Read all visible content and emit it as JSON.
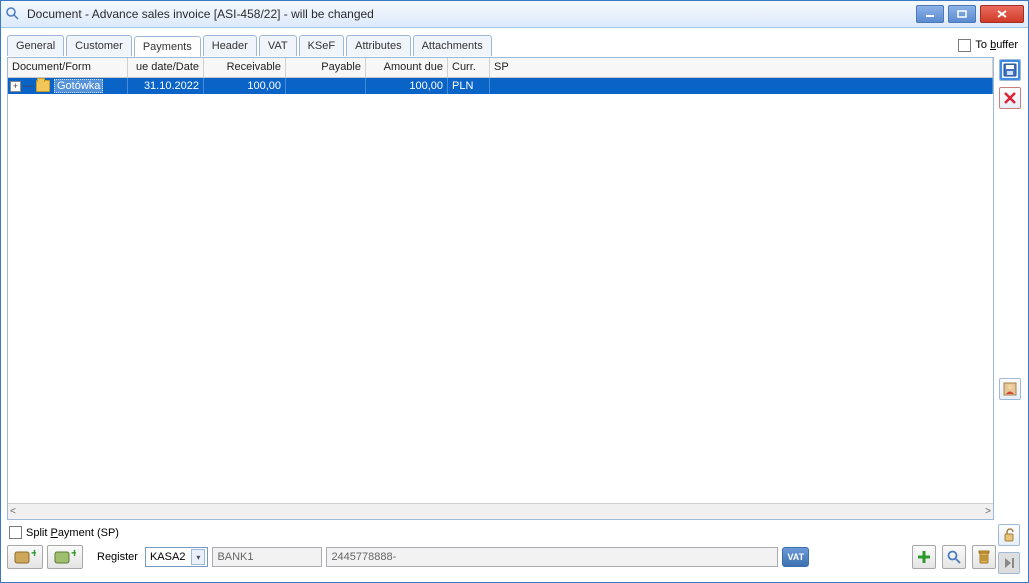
{
  "title": "Document - Advance sales invoice [ASI-458/22]  - will be changed",
  "buffer_label": "To buffer",
  "tabs": {
    "general": "General",
    "customer": "Customer",
    "payments": "Payments",
    "header": "Header",
    "vat": "VAT",
    "ksef": "KSeF",
    "attributes": "Attributes",
    "attachments": "Attachments"
  },
  "columns": {
    "document": "Document/Form",
    "date": "ue date/Date",
    "receivable": "Receivable",
    "payable": "Payable",
    "amount_due": "Amount due",
    "currency": "Curr.",
    "sp": "SP"
  },
  "rows": [
    {
      "document": "Gotówka",
      "date": "31.10.2022",
      "receivable": "100,00",
      "payable": "",
      "amount_due": "100,00",
      "currency": "PLN",
      "sp": ""
    }
  ],
  "split_label": "Split Payment (SP)",
  "register_label": "Register",
  "register_value": "KASA2",
  "bank_value": "BANK1",
  "account_value": "2445778888-",
  "vat_button": "VAT"
}
